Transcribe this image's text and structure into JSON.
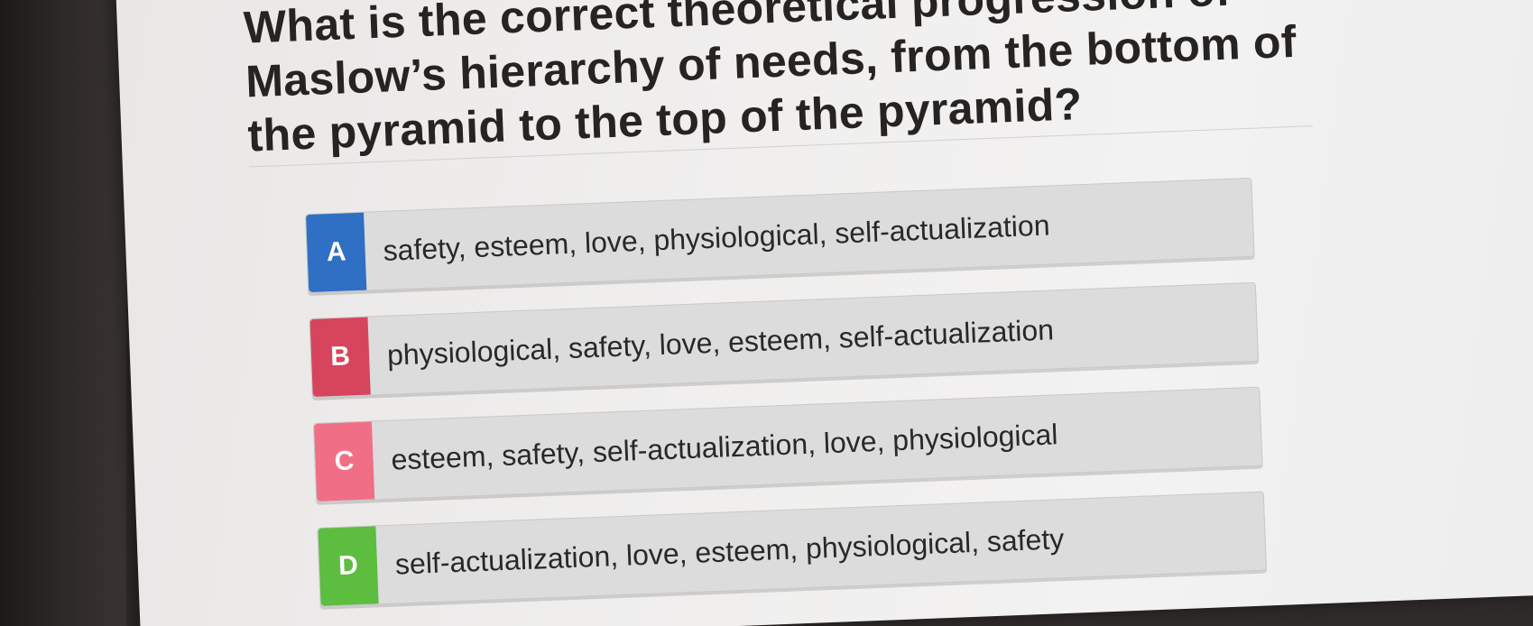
{
  "question": {
    "text": "What is the correct theoretical progression of Maslow’s hierarchy of needs, from the bottom of the pyramid to the top of the pyramid?"
  },
  "options": [
    {
      "letter": "A",
      "text": "safety, esteem, love, physiological, self-actualization",
      "color": "#2f6fc4"
    },
    {
      "letter": "B",
      "text": "physiological, safety, love, esteem, self-actualization",
      "color": "#d6455c"
    },
    {
      "letter": "C",
      "text": "esteem, safety, self-actualization, love, physiological",
      "color": "#f16f86"
    },
    {
      "letter": "D",
      "text": "self-actualization, love, esteem, physiological, safety",
      "color": "#5cbd3e"
    }
  ]
}
